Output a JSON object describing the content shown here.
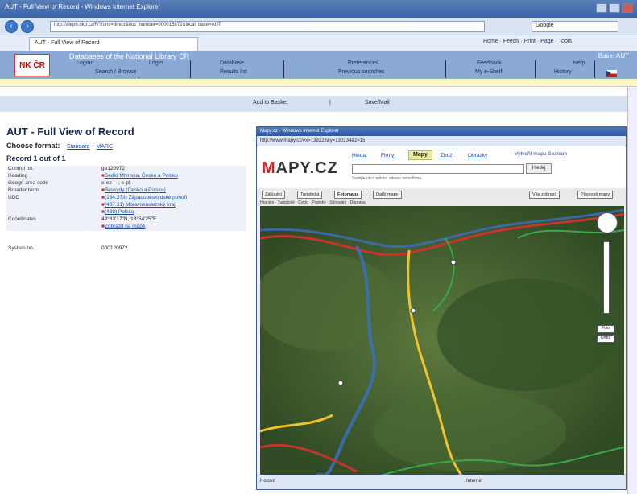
{
  "browser": {
    "title": "AUT - Full View of Record - Windows Internet Explorer",
    "url": "http://aleph.nkp.cz/F/?func=direct&doc_number=000015872&local_base=AUT",
    "search_placeholder": "Google",
    "tab_label": "AUT - Full View of Record",
    "tools": "Home  ·  Feeds  ·  Print  ·  Page  ·  Tools"
  },
  "site": {
    "logo": "NK ČR",
    "title": "Databases of the National Library CR",
    "status": "Base: AUT",
    "menu_row1": [
      "Logout",
      "Login",
      "Database",
      "Preferences",
      "Feedback",
      "Help"
    ],
    "menu_row2": [
      "Search / Browse",
      "Results list",
      "Previous searches",
      "My e-Shelf",
      "History"
    ]
  },
  "actions": [
    "Add to Basket",
    "Save/Mail"
  ],
  "page": {
    "title": "AUT - Full View of Record",
    "choose_format_label": "Choose format:",
    "formats": [
      "Standard",
      "MARC"
    ],
    "record_of": "Record 1 out of 1"
  },
  "record": [
    {
      "label": "Control no.",
      "value": "ge120972"
    },
    {
      "label": "Heading",
      "value": "Sedlo Mlynska, Česko a Polsko",
      "link": true
    },
    {
      "label": "Geogr. area code",
      "value": "e-ez--- ; e-pl---"
    },
    {
      "label": "Broader term",
      "value": "Beskydy (Česko a Polsko)",
      "link": true
    },
    {
      "label": "UDC",
      "value": "(234.373) Západobeskydské pohoří",
      "link": true
    },
    {
      "label": "",
      "value": "(437.31) Moravskoslezský kraj",
      "link": true
    },
    {
      "label": "",
      "value": "(438) Polsko",
      "link": true
    },
    {
      "label": "Coordinates",
      "value": "49°33'17\"N, 18°54'25\"E"
    },
    {
      "label": "",
      "value": "Zobrazit na mapě",
      "link": true
    },
    {
      "label": "System no.",
      "value": "000120972"
    }
  ],
  "popup": {
    "title": "Mapy.cz - Windows Internet Explorer",
    "address": "http://www.mapy.cz/#x=139223&y=130234&z=15",
    "logo_m": "M",
    "logo_rest": "APY.CZ",
    "tabs": [
      "Hledat",
      "Firmy",
      "Mapy",
      "Zboží",
      "Obrázky"
    ],
    "active_tab": "Mapy",
    "search_button": "Hledej",
    "search_hint": "Zadejte ulici, město, adresu nebo firmu",
    "right_links": "Vytvořit mapu   Seznam",
    "map_buttons": [
      "Základní",
      "Turistická",
      "Fotomapa",
      "Další mapy",
      "Vše zobrazit",
      "Půvnosti mapy"
    ],
    "active_map_button": "Fotomapa",
    "layers": [
      "Hranice",
      "Turistické",
      "Cyklo",
      "Popisky",
      "Stínování",
      "Doprava"
    ],
    "status_left": "Hotovo",
    "status_right": "Internet",
    "zoom_labels": [
      "Foto",
      "Ortho"
    ]
  },
  "colors": {
    "site_bar": "#8aa9d6",
    "accent": "#1a2a55",
    "popup_title": "#2d58a0"
  }
}
